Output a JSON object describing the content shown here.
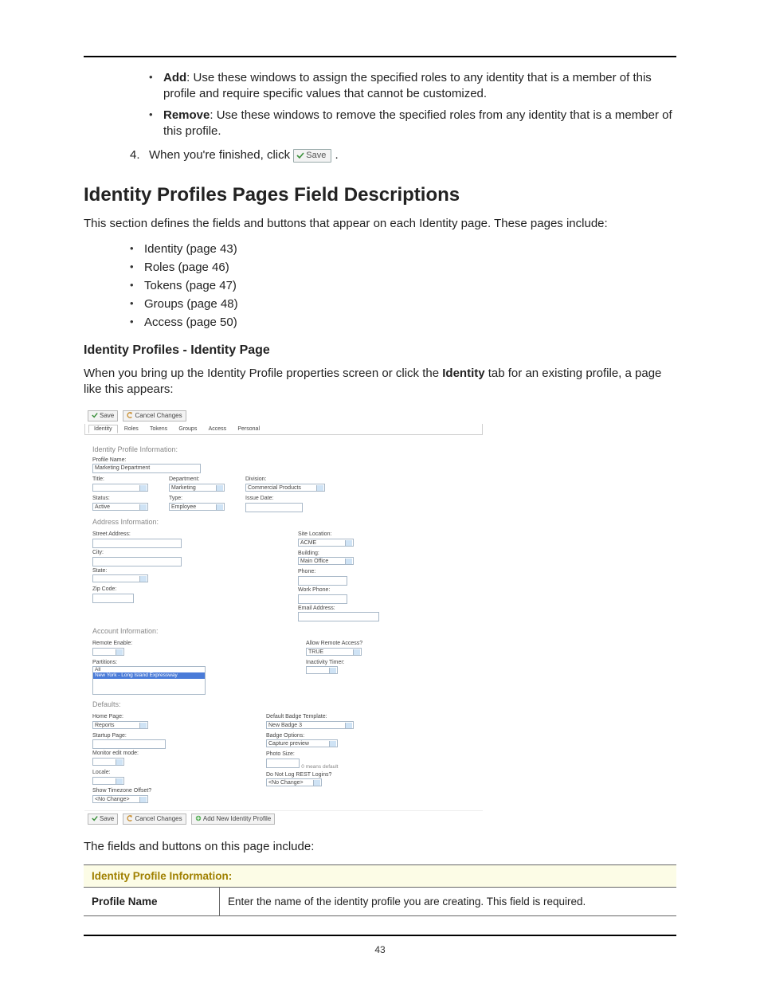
{
  "page_number": "43",
  "top_bullets": [
    {
      "term": "Add",
      "text": ": Use these windows to assign the specified roles to any identity that is a member of this profile and require specific values that cannot be customized."
    },
    {
      "term": "Remove",
      "text": ": Use these windows to remove the specified roles from any identity that is a member of this profile."
    }
  ],
  "step4": {
    "num": "4.",
    "before": "When you're finished, click ",
    "save_label": "Save",
    "after": " ."
  },
  "h1": "Identity Profiles Pages Field Descriptions",
  "lead": "This section defines the fields and buttons that appear on each Identity page. These pages include:",
  "toc": [
    "Identity (page 43)",
    "Roles (page 46)",
    "Tokens (page 47)",
    "Groups (page 48)",
    "Access (page 50)"
  ],
  "h2": "Identity Profiles - Identity Page",
  "intro": {
    "p1": "When you bring up the Identity Profile properties screen or click the ",
    "bold": "Identity",
    "p2": " tab for an existing profile, a page like this appears:"
  },
  "shot": {
    "buttons": {
      "save": "Save",
      "cancel": "Cancel Changes",
      "addnew": "Add New Identity Profile"
    },
    "tabs": [
      "Identity",
      "Roles",
      "Tokens",
      "Groups",
      "Access",
      "Personal"
    ],
    "groups": {
      "g1": "Identity Profile Information:",
      "g2": "Address Information:",
      "g3": "Account Information:",
      "g4": "Defaults:"
    },
    "info": {
      "profile_name_label": "Profile Name:",
      "profile_name": "Marketing Department",
      "title_label": "Title:",
      "dept_label": "Department:",
      "dept": "Marketing",
      "division_label": "Division:",
      "division": "Commercial Products",
      "status_label": "Status:",
      "status": "Active",
      "type_label": "Type:",
      "type": "Employee",
      "issue_label": "Issue Date:"
    },
    "addr": {
      "street": "Street Address:",
      "city": "City:",
      "state": "State:",
      "zip": "Zip Code:",
      "site": "Site Location:",
      "site_v": "ACME",
      "bldg": "Building:",
      "bldg_v": "Main Office",
      "phone": "Phone:",
      "work": "Work Phone:",
      "email": "Email Address:"
    },
    "acct": {
      "remote": "Remote Enable:",
      "allow": "Allow Remote Access?",
      "allow_v": "TRUE",
      "inact": "Inactivity Timer:",
      "parts": "Partitions:",
      "list": [
        "All",
        "New York - Long Island Expressway"
      ]
    },
    "def": {
      "home": "Home Page:",
      "home_v": "Reports",
      "badge": "Default Badge Template:",
      "badge_v": "New Badge 3",
      "startup": "Startup Page:",
      "options": "Badge Options:",
      "options_v": "Capture preview",
      "monitor": "Monitor edit mode:",
      "photo": "Photo Size:",
      "photo_hint": "0 means default",
      "locale": "Locale:",
      "rest": "Do Not Log REST Logins?",
      "rest_v": "<No Change>",
      "tz": "Show Timezone Offset?",
      "tz_v": "<No Change>"
    }
  },
  "after_shot": "The fields and buttons on this page include:",
  "table": {
    "header": "Identity Profile Information:",
    "row1_k": "Profile Name",
    "row1_v": "Enter the name of the identity profile you are creating. This field is required."
  }
}
